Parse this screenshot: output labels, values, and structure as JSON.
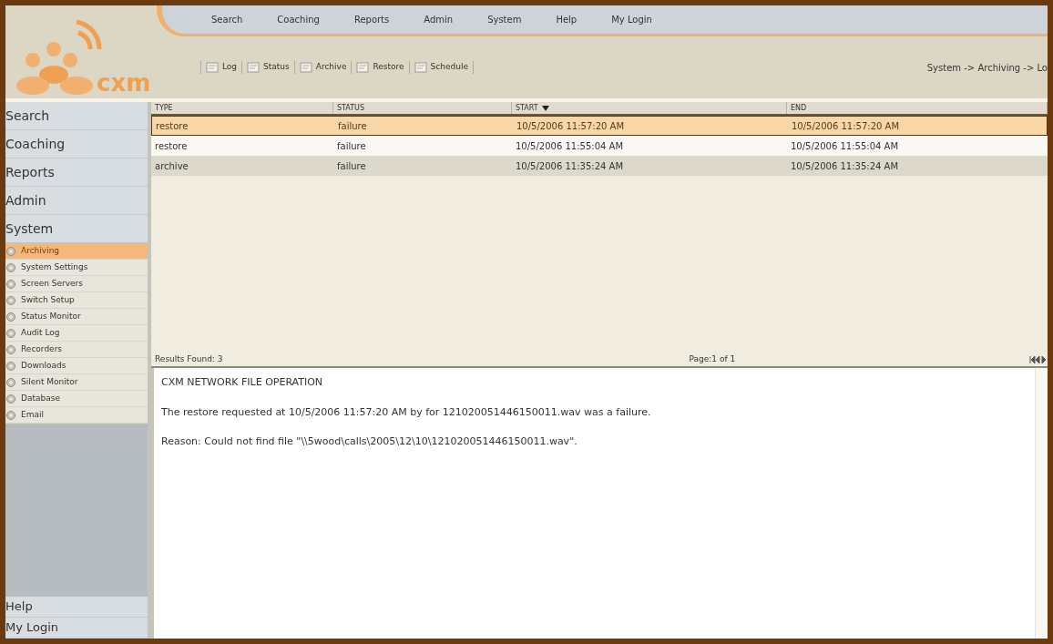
{
  "logo": {
    "text": "cxm"
  },
  "top_menu": [
    {
      "label": "Search"
    },
    {
      "label": "Coaching"
    },
    {
      "label": "Reports"
    },
    {
      "label": "Admin"
    },
    {
      "label": "System"
    },
    {
      "label": "Help"
    },
    {
      "label": "My Login"
    }
  ],
  "toolbar": [
    {
      "label": "Log"
    },
    {
      "label": "Status"
    },
    {
      "label": "Archive"
    },
    {
      "label": "Restore"
    },
    {
      "label": "Schedule"
    }
  ],
  "breadcrumb": "System -> Archiving -> Lo",
  "sidebar": {
    "sections": [
      {
        "label": "Search"
      },
      {
        "label": "Coaching"
      },
      {
        "label": "Reports"
      },
      {
        "label": "Admin"
      },
      {
        "label": "System"
      }
    ],
    "items": [
      {
        "label": "Archiving",
        "selected": true
      },
      {
        "label": "System Settings",
        "selected": false
      },
      {
        "label": "Screen Servers",
        "selected": false
      },
      {
        "label": "Switch Setup",
        "selected": false
      },
      {
        "label": "Status Monitor",
        "selected": false
      },
      {
        "label": "Audit Log",
        "selected": false
      },
      {
        "label": "Recorders",
        "selected": false
      },
      {
        "label": "Downloads",
        "selected": false
      },
      {
        "label": "Silent Monitor",
        "selected": false
      },
      {
        "label": "Database",
        "selected": false
      },
      {
        "label": "Email",
        "selected": false
      }
    ],
    "bottom_sections": [
      {
        "label": "Help"
      },
      {
        "label": "My Login"
      }
    ]
  },
  "table": {
    "columns": [
      {
        "label": "TYPE",
        "sorted": false
      },
      {
        "label": "STATUS",
        "sorted": false
      },
      {
        "label": "START",
        "sorted": true
      },
      {
        "label": "END",
        "sorted": false
      }
    ],
    "rows": [
      {
        "selected": true,
        "cells": [
          "restore",
          "failure",
          "10/5/2006 11:57:20 AM",
          "10/5/2006 11:57:20 AM"
        ]
      },
      {
        "selected": false,
        "cells": [
          "restore",
          "failure",
          "10/5/2006 11:55:04 AM",
          "10/5/2006 11:55:04 AM"
        ]
      },
      {
        "selected": false,
        "cells": [
          "archive",
          "failure",
          "10/5/2006 11:35:24 AM",
          "10/5/2006 11:35:24 AM"
        ]
      }
    ]
  },
  "results_found": "Results Found: 3",
  "page_info": "Page:1 of 1",
  "message": {
    "title": "CXM NETWORK FILE OPERATION",
    "lines": [
      "The restore requested at 10/5/2006 11:57:20 AM by  for 121020051446150011.wav was a failure.",
      "Reason: Could not find file \"\\\\5wood\\calls\\2005\\12\\10\\121020051446150011.wav\"."
    ]
  }
}
